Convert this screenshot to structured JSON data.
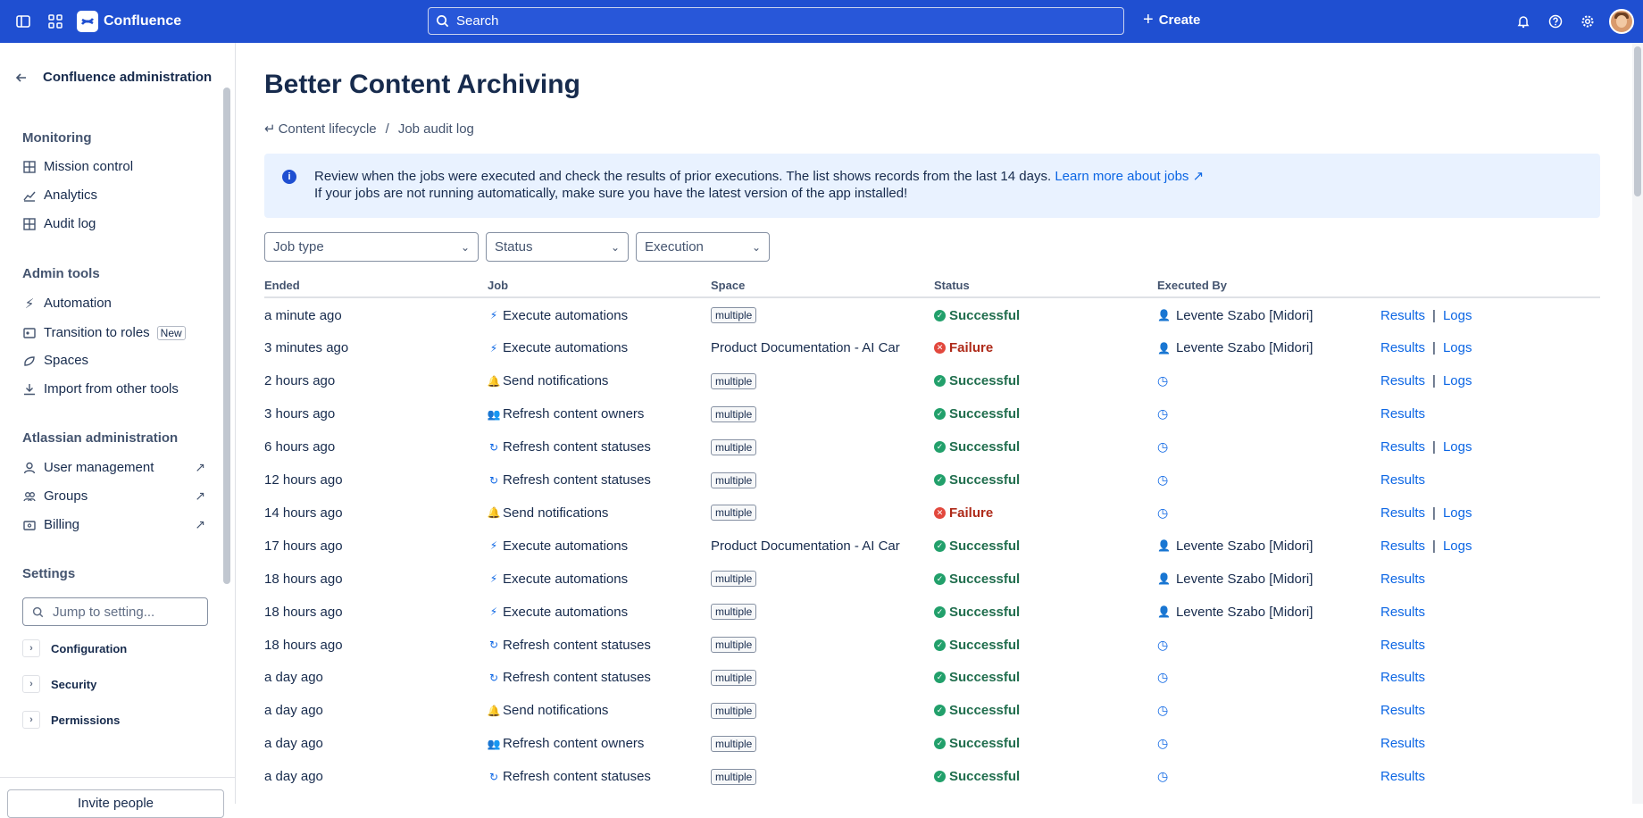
{
  "topbar": {
    "product": "Confluence",
    "search_placeholder": "Search",
    "create_label": "Create"
  },
  "sidebar": {
    "title": "Confluence administration",
    "monitoring_heading": "Monitoring",
    "monitoring": [
      {
        "label": "Mission control",
        "icon": "table-icon"
      },
      {
        "label": "Analytics",
        "icon": "chart-line-icon"
      },
      {
        "label": "Audit log",
        "icon": "table-icon"
      }
    ],
    "admin_tools_heading": "Admin tools",
    "admin_tools": [
      {
        "label": "Automation",
        "icon": "lightning-icon"
      },
      {
        "label": "Transition to roles",
        "icon": "roles-icon",
        "badge": "New"
      },
      {
        "label": "Spaces",
        "icon": "link-icon"
      },
      {
        "label": "Import from other tools",
        "icon": "download-icon"
      }
    ],
    "atlassian_heading": "Atlassian administration",
    "atlassian": [
      {
        "label": "User management",
        "icon": "person-icon"
      },
      {
        "label": "Groups",
        "icon": "people-icon"
      },
      {
        "label": "Billing",
        "icon": "billing-icon"
      }
    ],
    "settings_heading": "Settings",
    "settings_search_placeholder": "Jump to setting...",
    "settings_sections": [
      "Configuration",
      "Security",
      "Permissions"
    ],
    "invite_label": "Invite people"
  },
  "main": {
    "title": "Better Content Archiving",
    "breadcrumb": [
      "Content lifecycle",
      "/",
      "Job audit log"
    ],
    "info_line1": "Review when the jobs were executed and check the results of prior executions. The list shows records from the last 14 days.",
    "info_link": "Learn more about jobs",
    "info_line2": "If your jobs are not running automatically, make sure you have the latest version of the app installed!",
    "filters": [
      "Job type",
      "Status",
      "Execution"
    ],
    "columns": [
      "Ended",
      "Job",
      "Space",
      "Status",
      "Executed By"
    ],
    "results_label": "Results",
    "logs_label": "Logs",
    "rows": [
      {
        "ended": "a minute ago",
        "job": "Execute automations",
        "icon": "⚡",
        "space": "multiple",
        "status": "Successful",
        "by": "Levente Szabo [Midori]",
        "logs": true
      },
      {
        "ended": "3 minutes ago",
        "job": "Execute automations",
        "icon": "⚡",
        "space": "Product Documentation - AI Car",
        "status": "Failure",
        "by": "Levente Szabo [Midori]",
        "logs": true
      },
      {
        "ended": "2 hours ago",
        "job": "Send notifications",
        "icon": "🔔",
        "space": "multiple",
        "status": "Successful",
        "by": "",
        "logs": true
      },
      {
        "ended": "3 hours ago",
        "job": "Refresh content owners",
        "icon": "👥",
        "space": "multiple",
        "status": "Successful",
        "by": "",
        "logs": false
      },
      {
        "ended": "6 hours ago",
        "job": "Refresh content statuses",
        "icon": "↻",
        "space": "multiple",
        "status": "Successful",
        "by": "",
        "logs": true
      },
      {
        "ended": "12 hours ago",
        "job": "Refresh content statuses",
        "icon": "↻",
        "space": "multiple",
        "status": "Successful",
        "by": "",
        "logs": false
      },
      {
        "ended": "14 hours ago",
        "job": "Send notifications",
        "icon": "🔔",
        "space": "multiple",
        "status": "Failure",
        "by": "",
        "logs": true
      },
      {
        "ended": "17 hours ago",
        "job": "Execute automations",
        "icon": "⚡",
        "space": "Product Documentation - AI Car",
        "status": "Successful",
        "by": "Levente Szabo [Midori]",
        "logs": true
      },
      {
        "ended": "18 hours ago",
        "job": "Execute automations",
        "icon": "⚡",
        "space": "multiple",
        "status": "Successful",
        "by": "Levente Szabo [Midori]",
        "logs": false
      },
      {
        "ended": "18 hours ago",
        "job": "Execute automations",
        "icon": "⚡",
        "space": "multiple",
        "status": "Successful",
        "by": "Levente Szabo [Midori]",
        "logs": false
      },
      {
        "ended": "18 hours ago",
        "job": "Refresh content statuses",
        "icon": "↻",
        "space": "multiple",
        "status": "Successful",
        "by": "",
        "logs": false
      },
      {
        "ended": "a day ago",
        "job": "Refresh content statuses",
        "icon": "↻",
        "space": "multiple",
        "status": "Successful",
        "by": "",
        "logs": false
      },
      {
        "ended": "a day ago",
        "job": "Send notifications",
        "icon": "🔔",
        "space": "multiple",
        "status": "Successful",
        "by": "",
        "logs": false
      },
      {
        "ended": "a day ago",
        "job": "Refresh content owners",
        "icon": "👥",
        "space": "multiple",
        "status": "Successful",
        "by": "",
        "logs": false
      },
      {
        "ended": "a day ago",
        "job": "Refresh content statuses",
        "icon": "↻",
        "space": "multiple",
        "status": "Successful",
        "by": "",
        "logs": false
      }
    ]
  }
}
